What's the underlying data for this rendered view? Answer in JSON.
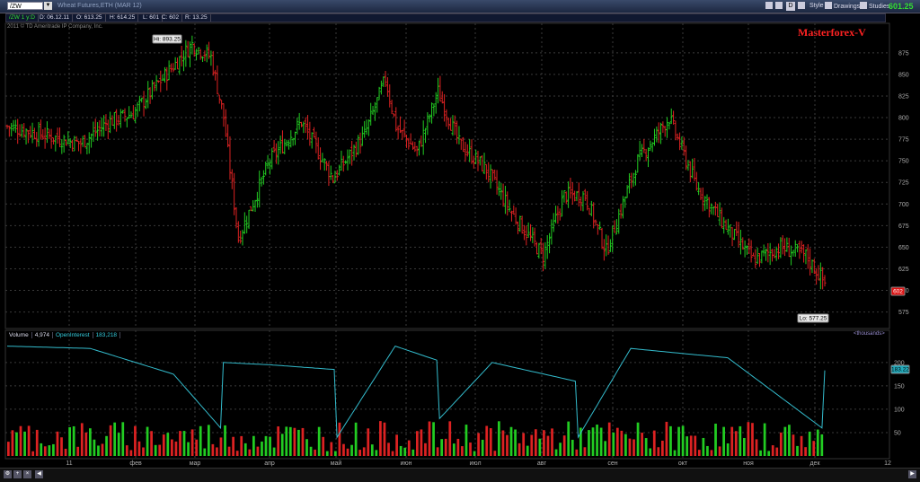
{
  "toolbar": {
    "symbol": "/ZW",
    "description": "Wheat Futures,ETH (MAR 12)",
    "style_label": "Style",
    "drawings_label": "Drawings",
    "studies_label": "Studies",
    "d_label": "D",
    "last_price": "601.25"
  },
  "info": {
    "agg": "/ZW 1 y:D",
    "date": "D: 06.12.11",
    "open": "O: 613.25",
    "high": "H: 614.25",
    "low": "L: 601",
    "close": "C: 602",
    "range": "R: 13.25"
  },
  "copyright": "2011 © TD Ameritrade IP Company, Inc.",
  "watermark": "Masterforex-V",
  "annotations": {
    "high": "Hi: 893.25",
    "low": "Lo: 577.25",
    "price_tag": "602",
    "oi_tag": "183.22"
  },
  "volume_panel": {
    "volume_label": "Volume",
    "volume_value": "4,974",
    "oi_label": "OpenInterest",
    "oi_value": "183,218",
    "units": "<thousands>"
  },
  "chart_data": [
    {
      "type": "ohlc",
      "ylim": [
        560,
        905
      ],
      "y_ticks": [
        575,
        600,
        625,
        650,
        675,
        700,
        725,
        750,
        775,
        800,
        825,
        850,
        875
      ],
      "x_ticks": [
        "11",
        "фев",
        "мар",
        "апр",
        "май",
        "июн",
        "июл",
        "авг",
        "сен",
        "окт",
        "ноя",
        "дек",
        "12"
      ],
      "anchor_x": [
        0,
        35,
        48,
        60,
        72,
        88,
        97,
        103,
        110,
        125,
        140,
        155,
        170,
        180,
        185,
        195,
        205,
        215,
        228,
        240,
        255,
        265,
        275,
        285,
        300,
        315,
        328,
        340,
        355,
        368,
        380,
        390
      ],
      "anchor_close": [
        790,
        770,
        795,
        805,
        840,
        885,
        870,
        800,
        660,
        750,
        795,
        730,
        780,
        845,
        790,
        760,
        830,
        770,
        740,
        690,
        640,
        710,
        710,
        645,
        750,
        800,
        720,
        680,
        635,
        650,
        640,
        605
      ],
      "colors": {
        "up": "#22cc22",
        "down": "#dd2222"
      }
    },
    {
      "type": "bar+line",
      "ylim": [
        0,
        240
      ],
      "y_ticks": [
        50,
        100,
        150,
        200
      ],
      "volume_range": [
        10,
        75
      ],
      "open_interest_anchor_x": [
        0,
        30,
        60,
        77,
        78,
        95,
        118,
        119,
        140,
        155,
        156,
        175,
        205,
        206,
        225,
        260,
        294,
        295
      ],
      "open_interest_anchor_values": [
        235,
        230,
        175,
        60,
        200,
        195,
        185,
        40,
        235,
        205,
        80,
        200,
        160,
        40,
        230,
        210,
        60,
        183
      ],
      "colors": {
        "open_interest": "#33bbcc"
      }
    }
  ]
}
